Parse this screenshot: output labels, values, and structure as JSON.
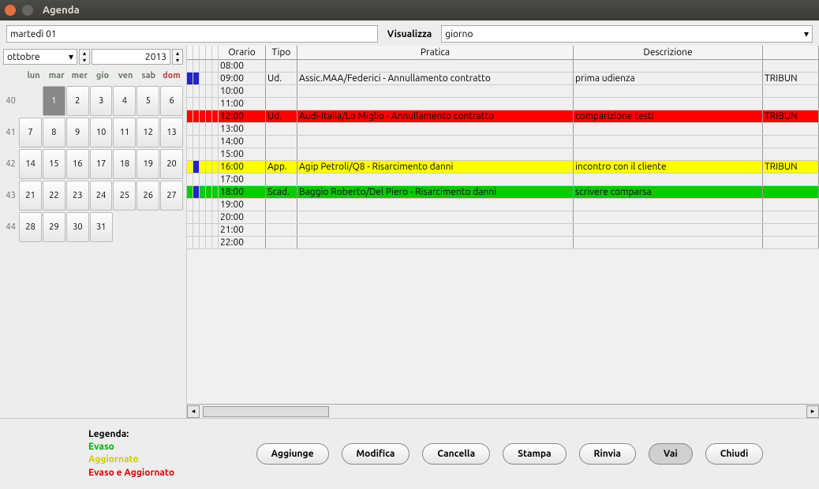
{
  "window": {
    "title": "Agenda"
  },
  "topbar": {
    "date_text": "martedì 01",
    "visualizza_label": "Visualizza",
    "visualizza_value": "giorno"
  },
  "calendar": {
    "month": "ottobre",
    "year": "2013",
    "dow": [
      "lun",
      "mar",
      "mer",
      "gio",
      "ven",
      "sab",
      "dom"
    ],
    "weeks": [
      {
        "num": "40",
        "days": [
          "",
          "1",
          "2",
          "3",
          "4",
          "5",
          "6"
        ]
      },
      {
        "num": "41",
        "days": [
          "7",
          "8",
          "9",
          "10",
          "11",
          "12",
          "13"
        ]
      },
      {
        "num": "42",
        "days": [
          "14",
          "15",
          "16",
          "17",
          "18",
          "19",
          "20"
        ]
      },
      {
        "num": "43",
        "days": [
          "21",
          "22",
          "23",
          "24",
          "25",
          "26",
          "27"
        ]
      },
      {
        "num": "44",
        "days": [
          "28",
          "29",
          "30",
          "31",
          "",
          "",
          ""
        ]
      }
    ],
    "selected_day": "1"
  },
  "schedule": {
    "columns": {
      "orario": "Orario",
      "tipo": "Tipo",
      "pratica": "Pratica",
      "descrizione": "Descrizione"
    },
    "rows": [
      {
        "orario": "08:00",
        "tipo": "",
        "pratica": "",
        "descrizione": "",
        "extra": "",
        "style": "",
        "markers": []
      },
      {
        "orario": "09:00",
        "tipo": "Ud.",
        "pratica": "Assic.MAA/Federici - Annullamento contratto",
        "descrizione": "prima udienza",
        "extra": "TRIBUN",
        "style": "",
        "markers": [
          "blue",
          "blue"
        ]
      },
      {
        "orario": "10:00",
        "tipo": "",
        "pratica": "",
        "descrizione": "",
        "extra": "",
        "style": "",
        "markers": []
      },
      {
        "orario": "11:00",
        "tipo": "",
        "pratica": "",
        "descrizione": "",
        "extra": "",
        "style": "",
        "markers": []
      },
      {
        "orario": "12:00",
        "tipo": "Ud.",
        "pratica": "Audi-Italia/Lo Miglio - Annullamento contratto",
        "descrizione": "comparizione testi",
        "extra": "TRIBUN",
        "style": "red",
        "markers": []
      },
      {
        "orario": "13:00",
        "tipo": "",
        "pratica": "",
        "descrizione": "",
        "extra": "",
        "style": "",
        "markers": []
      },
      {
        "orario": "14:00",
        "tipo": "",
        "pratica": "",
        "descrizione": "",
        "extra": "",
        "style": "",
        "markers": []
      },
      {
        "orario": "15:00",
        "tipo": "",
        "pratica": "",
        "descrizione": "",
        "extra": "",
        "style": "",
        "markers": []
      },
      {
        "orario": "16:00",
        "tipo": "App.",
        "pratica": "Agip Petroli/Q8 - Risarcimento danni",
        "descrizione": "incontro con il cliente",
        "extra": "TRIBUN",
        "style": "yellow",
        "markers": [
          "",
          "blue"
        ]
      },
      {
        "orario": "17:00",
        "tipo": "",
        "pratica": "",
        "descrizione": "",
        "extra": "",
        "style": "",
        "markers": []
      },
      {
        "orario": "18:00",
        "tipo": "Scad.",
        "pratica": "Baggio Roberto/Del Piero - Risarcimento danni",
        "descrizione": "scrivere comparsa",
        "extra": "",
        "style": "green",
        "markers": [
          "",
          "blue"
        ]
      },
      {
        "orario": "19:00",
        "tipo": "",
        "pratica": "",
        "descrizione": "",
        "extra": "",
        "style": "",
        "markers": []
      },
      {
        "orario": "20:00",
        "tipo": "",
        "pratica": "",
        "descrizione": "",
        "extra": "",
        "style": "",
        "markers": []
      },
      {
        "orario": "21:00",
        "tipo": "",
        "pratica": "",
        "descrizione": "",
        "extra": "",
        "style": "",
        "markers": []
      },
      {
        "orario": "22:00",
        "tipo": "",
        "pratica": "",
        "descrizione": "",
        "extra": "",
        "style": "",
        "markers": []
      }
    ]
  },
  "legend": {
    "title": "Legenda:",
    "evaso": "Evaso",
    "aggiornato": "Aggiornato",
    "evaso_e_aggiornato": "Evaso e Aggiornato"
  },
  "buttons": {
    "aggiunge": "Aggiunge",
    "modifica": "Modifica",
    "cancella": "Cancella",
    "stampa": "Stampa",
    "rinvia": "Rinvia",
    "vai": "Vai",
    "chiudi": "Chiudi"
  }
}
